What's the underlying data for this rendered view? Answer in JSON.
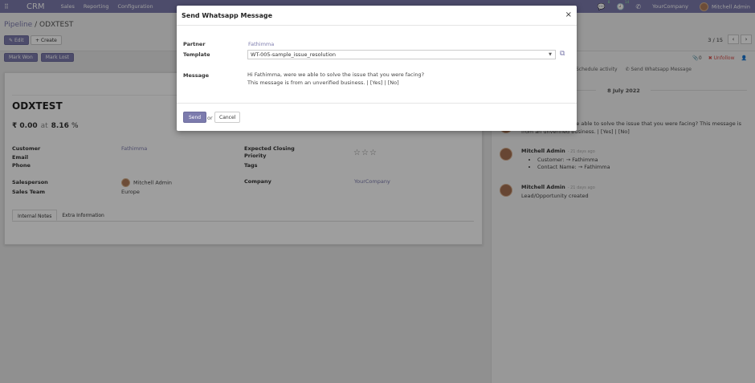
{
  "topnav": {
    "brand": "CRM",
    "menus": [
      "Sales",
      "Reporting",
      "Configuration"
    ],
    "chat_count": "8",
    "activity_count": "14",
    "company": "YourCompany",
    "user": "Mitchell Admin"
  },
  "control": {
    "breadcrumb_parent": "Pipeline",
    "breadcrumb_sep": " / ",
    "breadcrumb_current": "ODXTEST",
    "edit_label": "Edit",
    "create_label": "Create",
    "pager": "3 / 15"
  },
  "statusbar": {
    "mark_won": "Mark Won",
    "mark_lost": "Mark Lost"
  },
  "form": {
    "title": "ODXTEST",
    "revenue": "₹ 0.00",
    "at": "at",
    "probability": "8.16",
    "pct_sign": "%",
    "customer_label": "Customer",
    "customer_value": "Fathimma",
    "email_label": "Email",
    "phone_label": "Phone",
    "salesperson_label": "Salesperson",
    "salesperson_value": "Mitchell Admin",
    "salesteam_label": "Sales Team",
    "salesteam_value": "Europe",
    "expected_closing_label": "Expected Closing",
    "priority_label": "Priority",
    "tags_label": "Tags",
    "company_label": "Company",
    "company_value": "YourCompany",
    "priority_stars": 0,
    "tabs": [
      "Internal Notes",
      "Extra Information"
    ]
  },
  "chatter": {
    "followers": "0",
    "unfollow": "Unfollow",
    "schedule_activity": "Schedule activity",
    "send_whatsapp": "Send Whatsapp Message",
    "date": "8 July 2022",
    "messages": [
      {
        "text": "Hi Fathimma, were we able to solve the issue that you were facing? This message is from an unverified business. | [Yes] | [No]"
      },
      {
        "author": "Mitchell Admin",
        "time": "- 21 days ago",
        "items": [
          "Customer: → Fathimma",
          "Contact Name: → Fathimma"
        ]
      },
      {
        "author": "Mitchell Admin",
        "time": "- 21 days ago",
        "text": "Lead/Opportunity created"
      }
    ]
  },
  "modal": {
    "title": "Send Whatsapp Message",
    "close": "×",
    "partner_label": "Partner",
    "partner_value": "Fathimma",
    "template_label": "Template",
    "template_value": "WT-005-sample_issue_resolution",
    "message_label": "Message",
    "message_line1": "Hi Fathimma, were we able to solve the issue that you were facing?",
    "message_line2": "This message is from an unverified business. | [Yes] | [No]",
    "send_label": "Send",
    "or_label": "or",
    "cancel_label": "Cancel"
  },
  "icons": {
    "apps": "apps-grid-icon",
    "external": "external-link-icon"
  },
  "colors": {
    "brand": "#7c7bad",
    "unfollow": "#d9534f"
  }
}
